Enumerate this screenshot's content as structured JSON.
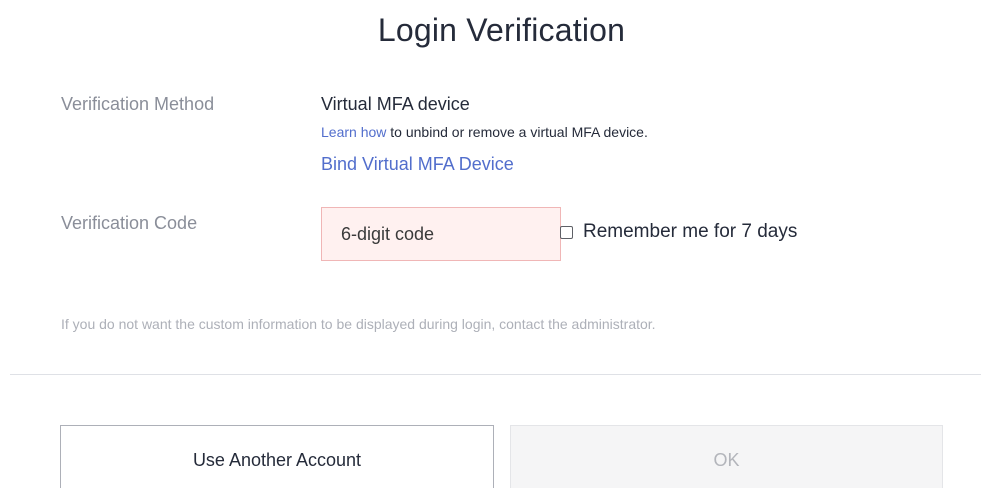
{
  "title": "Login Verification",
  "verification_method": {
    "label": "Verification Method",
    "value": "Virtual MFA device",
    "learn_link": "Learn how",
    "learn_text": " to unbind or remove a virtual MFA device.",
    "bind_link": "Bind Virtual MFA Device"
  },
  "verification_code": {
    "label": "Verification Code",
    "placeholder": "6-digit code",
    "value": "",
    "remember_label": "Remember me for 7 days",
    "remember_checked": false
  },
  "notice": "If you do not want the custom information to be displayed during login, contact the administrator.",
  "buttons": {
    "other_account": "Use Another Account",
    "ok": "OK"
  },
  "colors": {
    "link": "#526ecc",
    "input_error_bg": "#fff1f0",
    "input_error_border": "#f0b6b6",
    "disabled_bg": "#f5f5f6"
  }
}
